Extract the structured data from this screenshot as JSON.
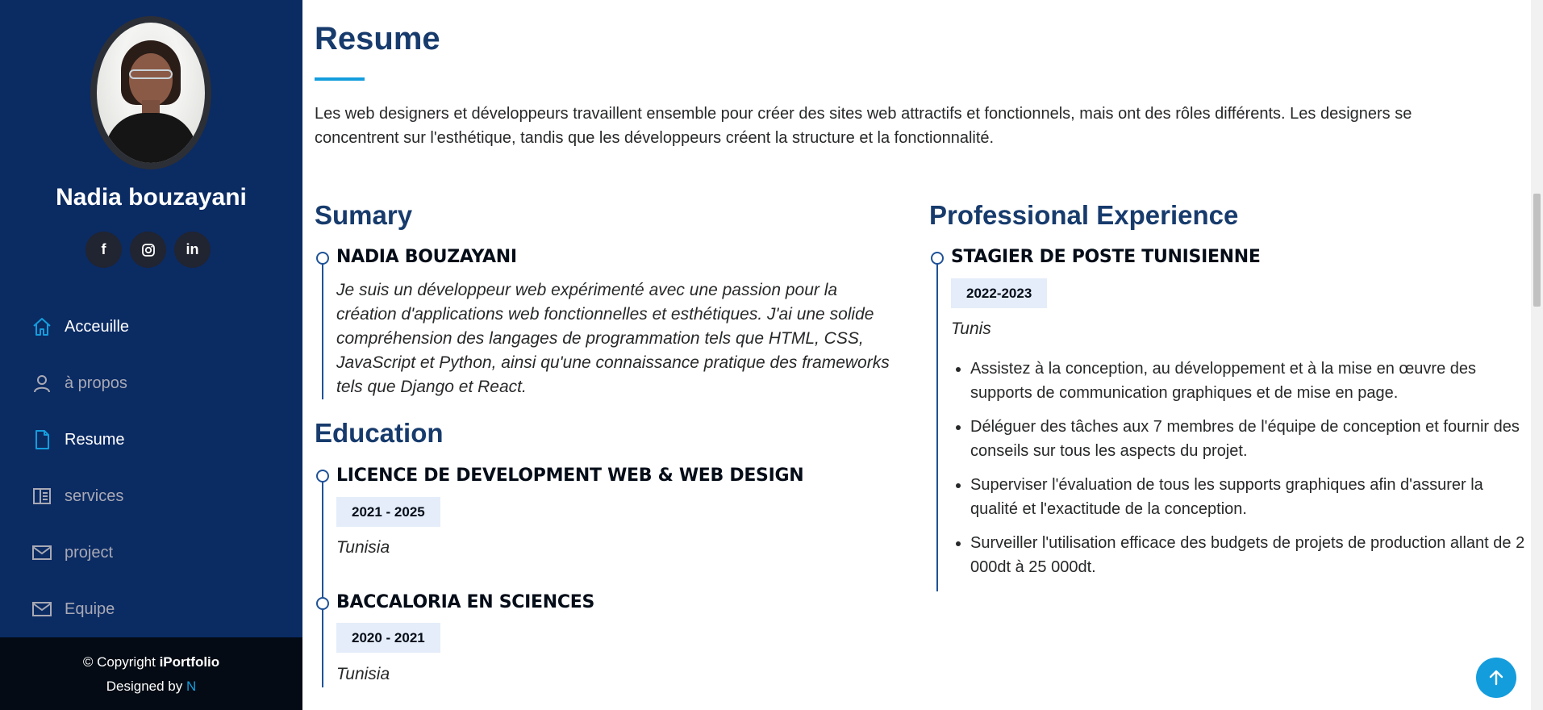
{
  "sidebar": {
    "name": "Nadia bouzayani",
    "socials": [
      {
        "icon": "facebook-icon",
        "glyph": "f"
      },
      {
        "icon": "instagram-icon"
      },
      {
        "icon": "linkedin-icon",
        "glyph": "in"
      }
    ],
    "nav": [
      {
        "label": "Acceuille",
        "icon": "house-icon",
        "active": true
      },
      {
        "label": "à propos",
        "icon": "person-icon",
        "active": false
      },
      {
        "label": "Resume",
        "icon": "file-icon",
        "active": true
      },
      {
        "label": "services",
        "icon": "layout-icon",
        "active": false
      },
      {
        "label": "project",
        "icon": "envelope-icon",
        "active": false
      },
      {
        "label": "Equipe",
        "icon": "envelope-icon",
        "active": false
      }
    ],
    "footer": {
      "copyright_prefix": "© Copyright ",
      "brand": "iPortfolio",
      "designed_by": "Designed by ",
      "designer": "N"
    }
  },
  "resume": {
    "title": "Resume",
    "intro": "Les web designers et développeurs travaillent ensemble pour créer des sites web attractifs et fonctionnels, mais ont des rôles différents. Les designers se concentrent sur l'esthétique, tandis que les développeurs créent la structure et la fonctionnalité.",
    "summary": {
      "heading": "Sumary",
      "name": "NADIA BOUZAYANI",
      "text": "Je suis un développeur web expérimenté avec une passion pour la création d'applications web fonctionnelles et esthétiques. J'ai une solide compréhension des langages de programmation tels que HTML, CSS, JavaScript et Python, ainsi qu'une connaissance pratique des frameworks tels que Django et React."
    },
    "education": {
      "heading": "Education",
      "items": [
        {
          "title": "LICENCE DE DEVELOPMENT WEB & WEB DESIGN",
          "years": "2021 - 2025",
          "place": "Tunisia"
        },
        {
          "title": "BACCALORIA EN SCIENCES",
          "years": "2020 - 2021",
          "place": "Tunisia"
        }
      ]
    },
    "experience": {
      "heading": "Professional Experience",
      "title": "STAGIER DE POSTE TUNISIENNE",
      "years": "2022-2023",
      "place": "Tunis",
      "bullets": [
        "Assistez à la conception, au développement et à la mise en œuvre des supports de communication graphiques et de mise en page.",
        "Déléguer des tâches aux 7 membres de l'équipe de conception et fournir des conseils sur tous les aspects du projet.",
        "Superviser l'évaluation de tous les supports graphiques afin d'assurer la qualité et l'exactitude de la conception.",
        "Surveiller l'utilisation efficace des budgets de projets de production allant de 2 000dt à 25 000dt."
      ]
    }
  },
  "colors": {
    "sidebar_bg": "#0b2b63",
    "accent": "#149ddd",
    "heading": "#173b6c"
  }
}
